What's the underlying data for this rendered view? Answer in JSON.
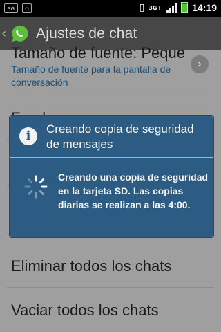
{
  "status_bar": {
    "left_badge": "3G",
    "network": "3G+",
    "time": "14:19"
  },
  "action_bar": {
    "title": "Ajustes de chat"
  },
  "settings": {
    "font_size": {
      "title": "Tamaño de fuente: Peque",
      "subtitle": "Tamaño de fuente para la pantalla de conversación"
    },
    "partial_row_title": "Fondo",
    "delete_all": "Eliminar todos los chats",
    "clear_all": "Vaciar todos los chats"
  },
  "dialog": {
    "title": "Creando copia de seguridad de mensajes",
    "message": "Creando una copia de seguridad en la tarjeta SD. Las copias diarias se realizan a las 4:00."
  }
}
